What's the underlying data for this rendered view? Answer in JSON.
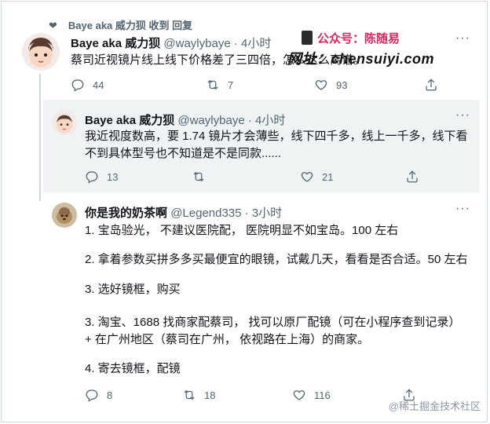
{
  "context": {
    "label": "Baye aka 威力狈 收到 回复"
  },
  "promo": {
    "line1": "公众号：陈随易",
    "line2": "网址：chensuiyi.com"
  },
  "tweet1": {
    "name": "Baye aka 威力狈",
    "handle": "@waylybaye",
    "time": "· 4小时",
    "text": "蔡司近视镜片线上线下价格差了三四倍，怎么这么离谱。",
    "replies": "44",
    "retweets": "7",
    "likes": "93"
  },
  "tweet2": {
    "name": "Baye aka 威力狈",
    "handle": "@waylybaye",
    "time": "· 4小时",
    "text": "我近视度数高，要 1.74 镜片才会薄些，线下四千多，线上一千多，线下看不到具体型号也不知道是不是同款......",
    "replies": "13",
    "retweets": "",
    "likes": "21"
  },
  "tweet3": {
    "name": "你是我的奶茶啊",
    "handle": "@Legend335",
    "time": "· 3小时",
    "lines": [
      "1. 宝岛验光，  不建议医院配，  医院明显不如宝岛。100 左右",
      "2. 拿着参数买拼多多买最便宜的眼镜，试戴几天，看看是否合适。50 左右",
      "3. 选好镜框，购买",
      "3. 淘宝、1688 找商家配蔡司，  找可以原厂配镜（可在小程序查到记录）",
      "+ 在广州地区（蔡司在广州，  依视路在上海）的商家。",
      "4. 寄去镜框，配镜"
    ],
    "replies": "8",
    "retweets": "18",
    "likes": "116"
  },
  "watermark": "@稀土掘金技术社区",
  "icons": {
    "reply": "reply-icon",
    "retweet": "retweet-icon",
    "like": "like-icon",
    "share": "share-icon",
    "more": "more-icon"
  }
}
